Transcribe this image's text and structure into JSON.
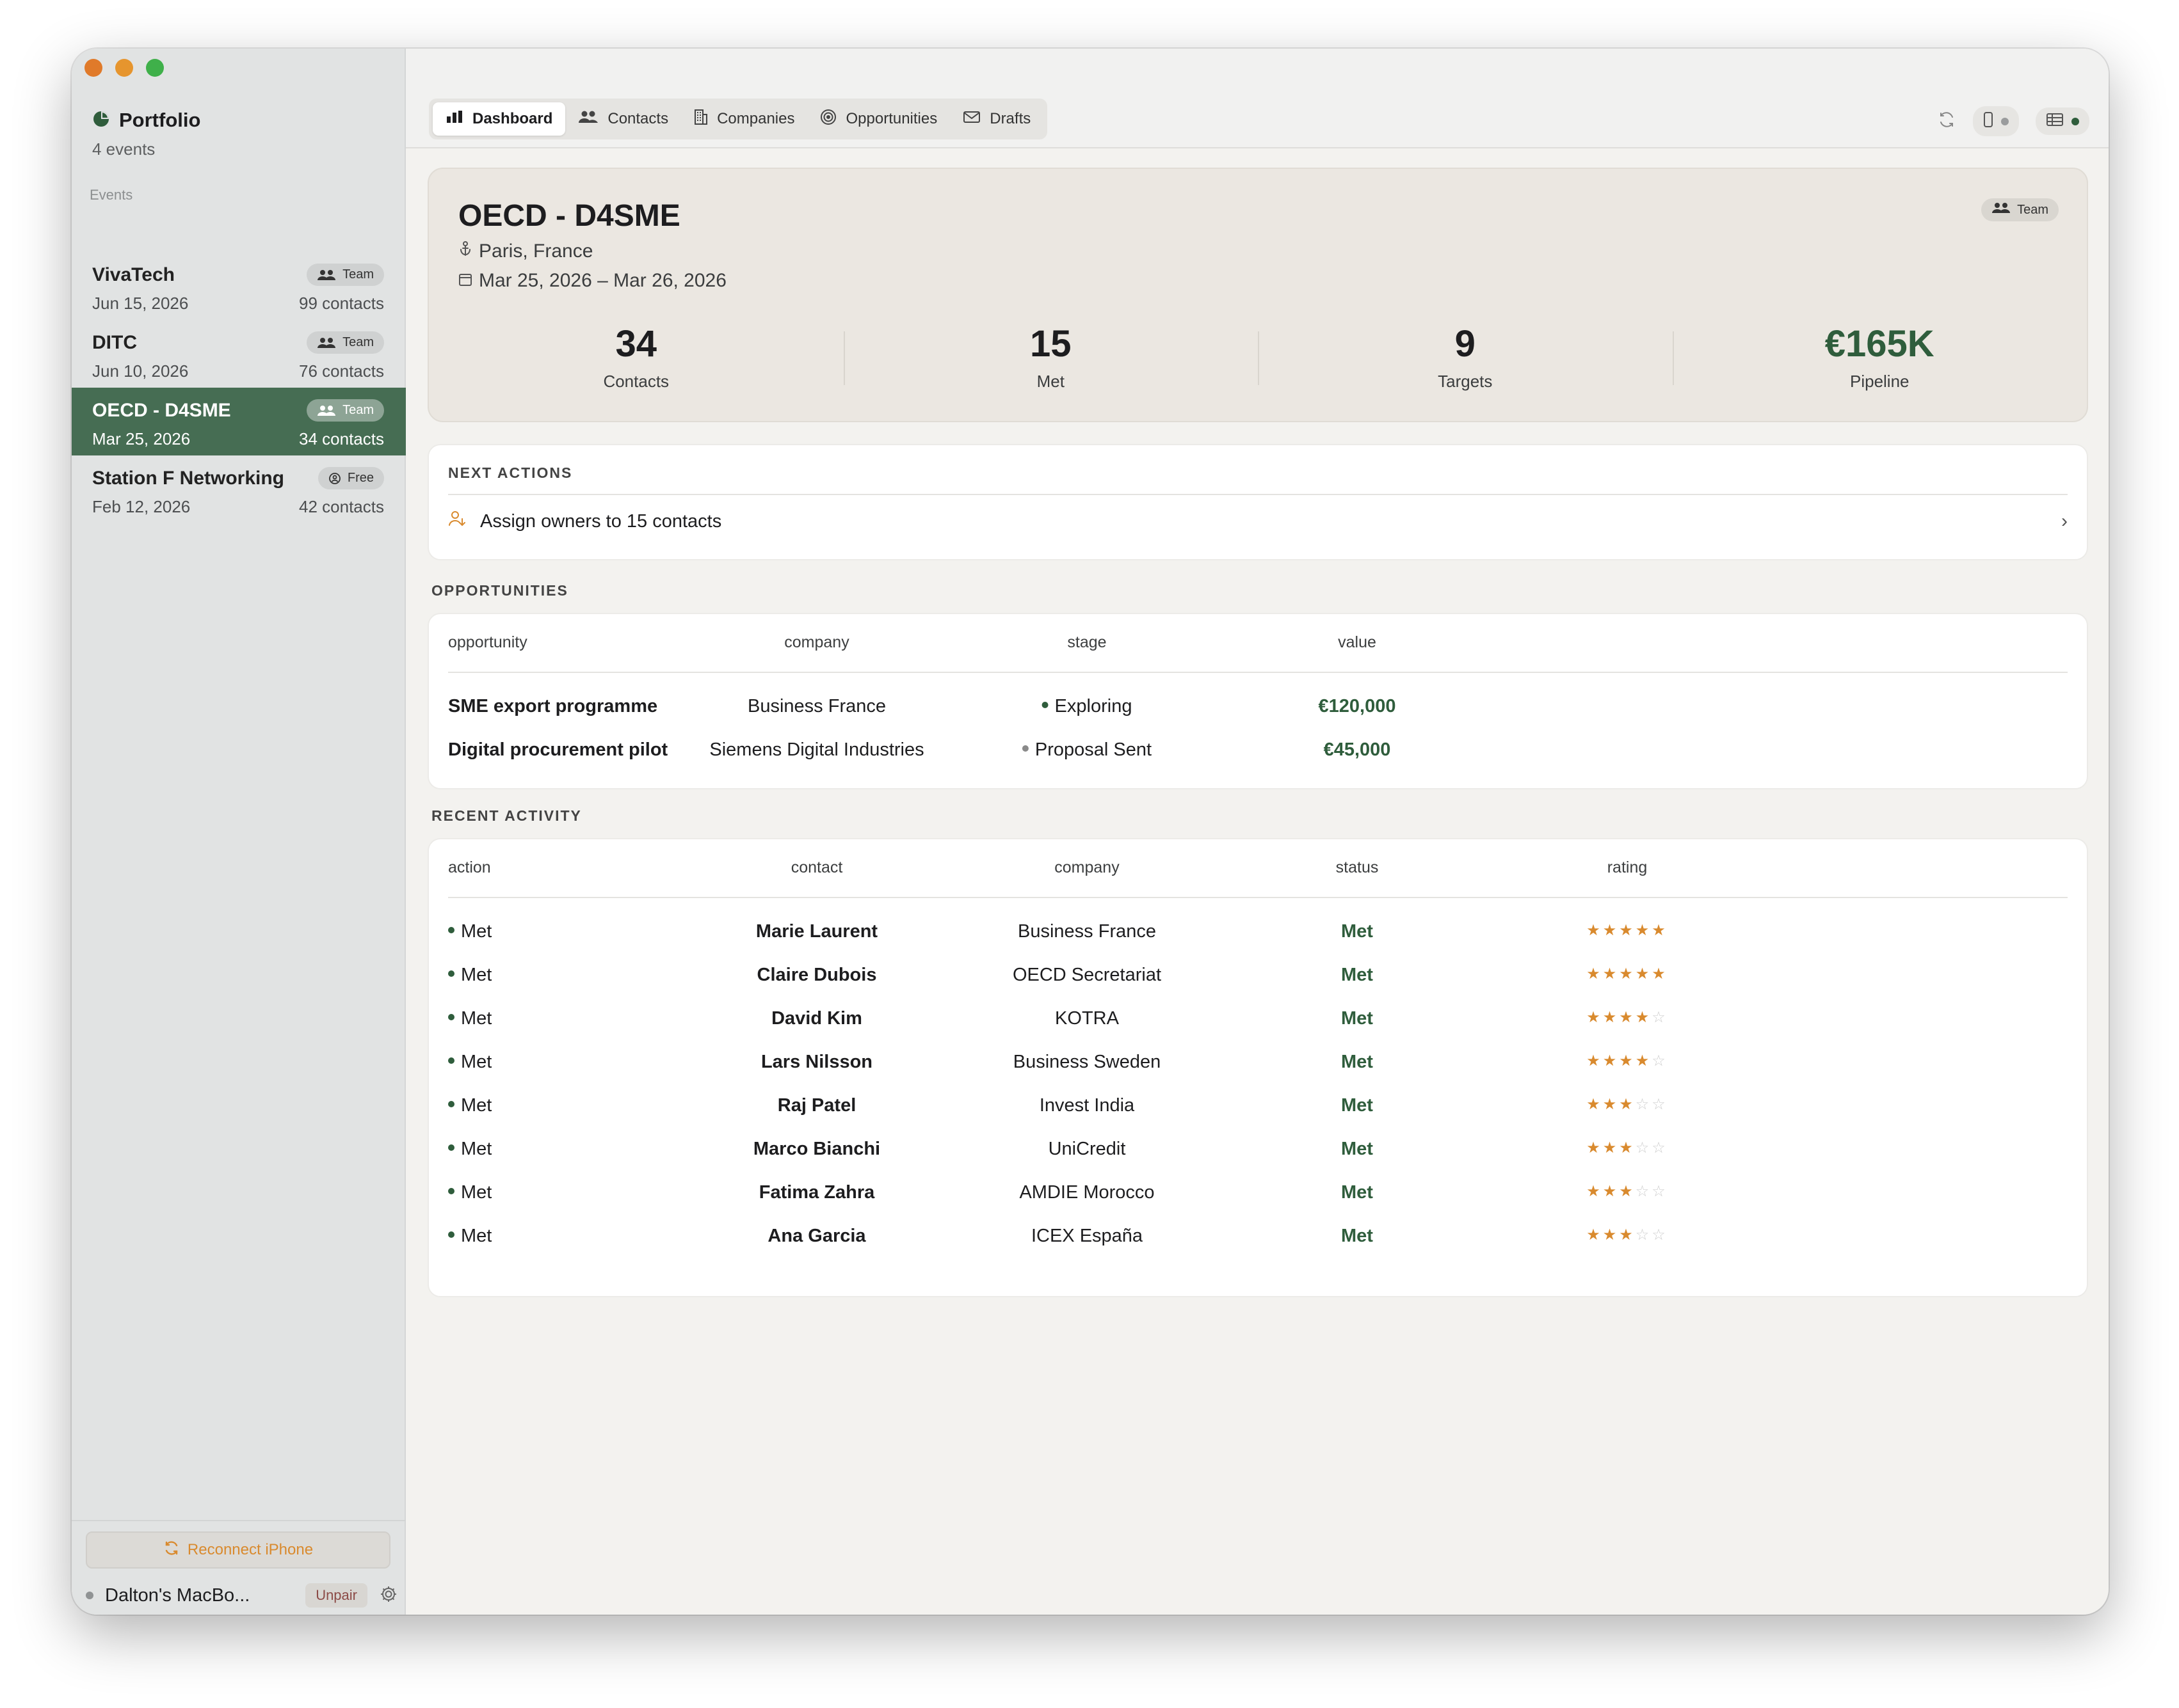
{
  "sidebar": {
    "portfolio_title": "Portfolio",
    "portfolio_sub": "4 events",
    "events_label": "Events",
    "events": [
      {
        "name": "VivaTech",
        "date": "Jun 15, 2026",
        "count": "99 contacts",
        "badge": "Team"
      },
      {
        "name": "DITC",
        "date": "Jun 10, 2026",
        "count": "76 contacts",
        "badge": "Team"
      },
      {
        "name": "OECD - D4SME",
        "date": "Mar 25, 2026",
        "count": "34 contacts",
        "badge": "Team"
      },
      {
        "name": "Station F Networking",
        "date": "Feb 12, 2026",
        "count": "42 contacts",
        "badge": "Free"
      }
    ],
    "selected_index": 2,
    "reconnect_label": "Reconnect iPhone",
    "device_name": "Dalton's MacBo...",
    "unpair_label": "Unpair"
  },
  "tabs": [
    {
      "label": "Dashboard",
      "icon": "bar-chart-icon",
      "active": true
    },
    {
      "label": "Contacts",
      "icon": "people-icon",
      "active": false
    },
    {
      "label": "Companies",
      "icon": "building-icon",
      "active": false
    },
    {
      "label": "Opportunities",
      "icon": "target-icon",
      "active": false
    },
    {
      "label": "Drafts",
      "icon": "envelope-icon",
      "active": false
    }
  ],
  "event": {
    "title": "OECD - D4SME",
    "location": "Paris, France",
    "dates": "Mar 25, 2026 – Mar 26, 2026",
    "badge": "Team",
    "stats": [
      {
        "value": "34",
        "label": "Contacts"
      },
      {
        "value": "15",
        "label": "Met"
      },
      {
        "value": "9",
        "label": "Targets"
      },
      {
        "value": "€165K",
        "label": "Pipeline"
      }
    ]
  },
  "next_actions": {
    "label": "NEXT ACTIONS",
    "items": [
      "Assign owners to 15 contacts"
    ]
  },
  "opportunities": {
    "label": "OPPORTUNITIES",
    "headers": [
      "opportunity",
      "company",
      "stage",
      "value"
    ],
    "rows": [
      {
        "opportunity": "SME export programme",
        "company": "Business France",
        "stage": "Exploring",
        "stage_color": "#2f5d3c",
        "value": "€120,000"
      },
      {
        "opportunity": "Digital procurement pilot",
        "company": "Siemens Digital Industries",
        "stage": "Proposal Sent",
        "stage_color": "#8a8a8a",
        "value": "€45,000"
      }
    ]
  },
  "activity": {
    "label": "RECENT ACTIVITY",
    "headers": [
      "action",
      "contact",
      "company",
      "status",
      "rating"
    ],
    "rows": [
      {
        "action": "Met",
        "contact": "Marie Laurent",
        "company": "Business France",
        "status": "Met",
        "rating": 5
      },
      {
        "action": "Met",
        "contact": "Claire Dubois",
        "company": "OECD Secretariat",
        "status": "Met",
        "rating": 5
      },
      {
        "action": "Met",
        "contact": "David Kim",
        "company": "KOTRA",
        "status": "Met",
        "rating": 4
      },
      {
        "action": "Met",
        "contact": "Lars Nilsson",
        "company": "Business Sweden",
        "status": "Met",
        "rating": 4
      },
      {
        "action": "Met",
        "contact": "Raj Patel",
        "company": "Invest India",
        "status": "Met",
        "rating": 3
      },
      {
        "action": "Met",
        "contact": "Marco Bianchi",
        "company": "UniCredit",
        "status": "Met",
        "rating": 3
      },
      {
        "action": "Met",
        "contact": "Fatima Zahra",
        "company": "AMDIE Morocco",
        "status": "Met",
        "rating": 3
      },
      {
        "action": "Met",
        "contact": "Ana Garcia",
        "company": "ICEX España",
        "status": "Met",
        "rating": 3
      }
    ]
  },
  "colors": {
    "accent_green": "#466d53",
    "text_green": "#2f5d3c",
    "orange": "#d98a2e"
  }
}
